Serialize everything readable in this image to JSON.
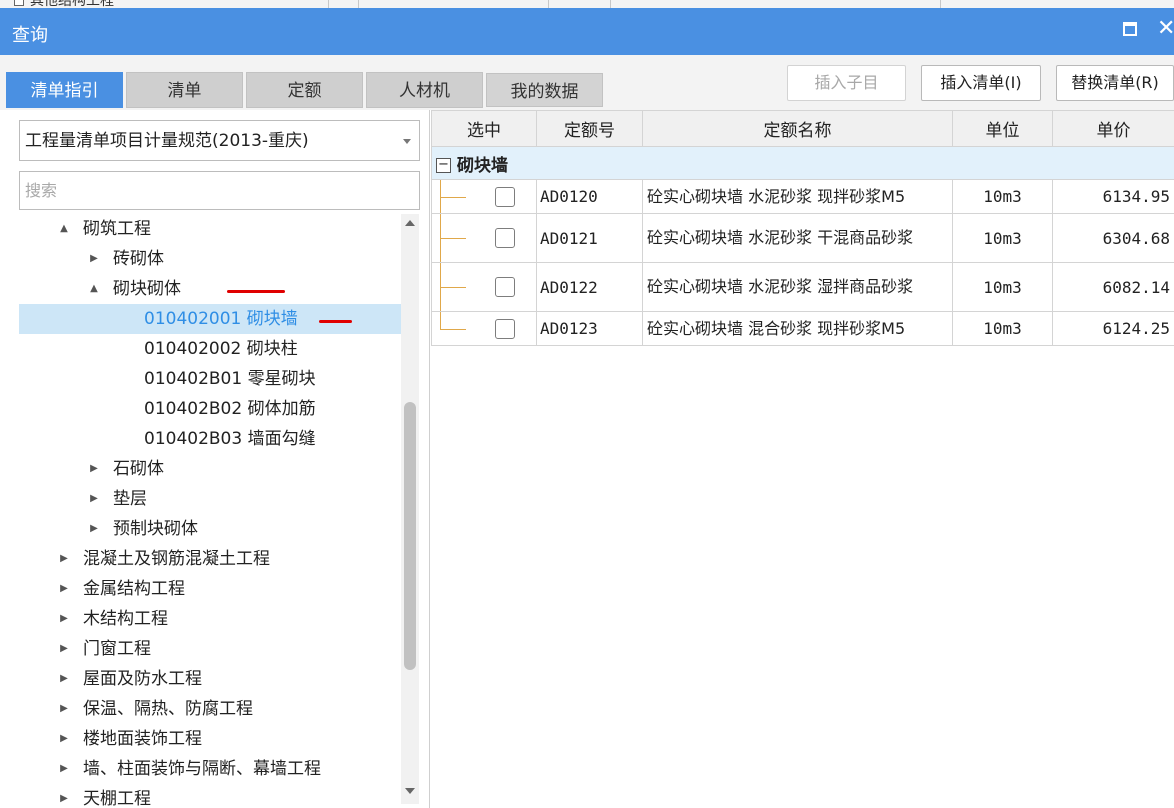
{
  "background_strip": {
    "left_text": "其他结构工程",
    "right_text": ""
  },
  "window": {
    "title": "查询"
  },
  "tabs": [
    {
      "label": "清单指引",
      "active": true
    },
    {
      "label": "清单",
      "active": false
    },
    {
      "label": "定额",
      "active": false
    },
    {
      "label": "人材机",
      "active": false
    },
    {
      "label": "我的数据",
      "active": false
    }
  ],
  "actions": {
    "insert_child": "插入子目",
    "insert_list": "插入清单(I)",
    "replace_list": "替换清单(R)"
  },
  "left_panel": {
    "spec_select": "工程量清单项目计量规范(2013-重庆)",
    "search_placeholder": "搜索",
    "tree": [
      {
        "label": "砌筑工程",
        "toggle": "▲"
      },
      {
        "label": "砖砌体",
        "toggle": "▶"
      },
      {
        "label": "砌块砌体",
        "toggle": "▲"
      },
      {
        "label": "010402001  砌块墙",
        "toggle": ""
      },
      {
        "label": "010402002  砌块柱",
        "toggle": ""
      },
      {
        "label": "010402B01  零星砌块",
        "toggle": ""
      },
      {
        "label": "010402B02  砌体加筋",
        "toggle": ""
      },
      {
        "label": "010402B03  墙面勾缝",
        "toggle": ""
      },
      {
        "label": "石砌体",
        "toggle": "▶"
      },
      {
        "label": "垫层",
        "toggle": "▶"
      },
      {
        "label": "预制块砌体",
        "toggle": "▶"
      },
      {
        "label": "混凝土及钢筋混凝土工程",
        "toggle": "▶"
      },
      {
        "label": "金属结构工程",
        "toggle": "▶"
      },
      {
        "label": "木结构工程",
        "toggle": "▶"
      },
      {
        "label": "门窗工程",
        "toggle": "▶"
      },
      {
        "label": "屋面及防水工程",
        "toggle": "▶"
      },
      {
        "label": "保温、隔热、防腐工程",
        "toggle": "▶"
      },
      {
        "label": "楼地面装饰工程",
        "toggle": "▶"
      },
      {
        "label": "墙、柱面装饰与隔断、幕墙工程",
        "toggle": "▶"
      },
      {
        "label": "天棚工程",
        "toggle": "▶"
      }
    ]
  },
  "grid": {
    "headers": {
      "select": "选中",
      "code": "定额号",
      "name": "定额名称",
      "unit": "单位",
      "price": "单价"
    },
    "group": {
      "toggle": "−",
      "label": "砌块墙"
    },
    "rows": [
      {
        "code": "AD0120",
        "name": "砼实心砌块墙 水泥砂浆 现拌砂浆M5",
        "unit": "10m3",
        "price": "6134.95"
      },
      {
        "code": "AD0121",
        "name": "砼实心砌块墙 水泥砂浆 干混商品砂浆",
        "unit": "10m3",
        "price": "6304.68"
      },
      {
        "code": "AD0122",
        "name": "砼实心砌块墙 水泥砂浆 湿拌商品砂浆",
        "unit": "10m3",
        "price": "6082.14"
      },
      {
        "code": "AD0123",
        "name": "砼实心砌块墙 混合砂浆 现拌砂浆M5",
        "unit": "10m3",
        "price": "6124.25"
      }
    ]
  },
  "colors": {
    "accent": "#4a90e2",
    "selection": "#cde6f7",
    "annotation": "#e00000"
  }
}
